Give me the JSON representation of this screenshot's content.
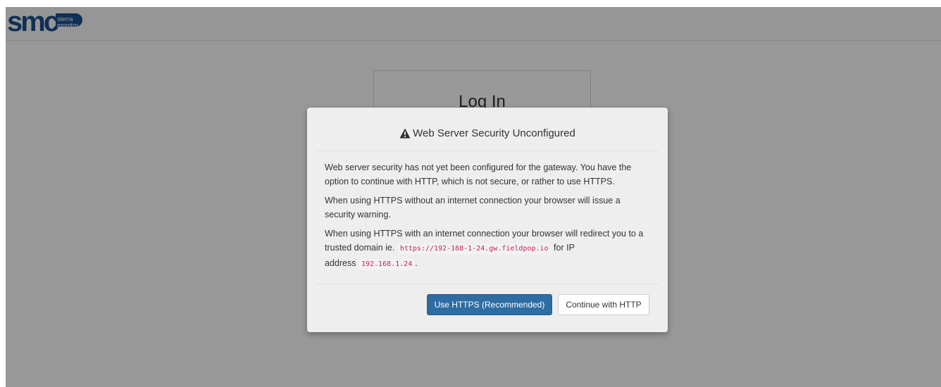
{
  "brand": {
    "logo_mark": "smc",
    "logo_sub_line1": "sierra",
    "logo_sub_line2": "monitor",
    "color": "#1b4f8f"
  },
  "background": {
    "login_title": "Log In"
  },
  "modal": {
    "title": "Web Server Security Unconfigured",
    "icon": "warning-triangle-icon",
    "paragraph1": "Web server security has not yet been configured for the gateway. You have the option to continue with HTTP, which is not secure, or rather to use HTTPS.",
    "paragraph2": "When using HTTPS without an internet connection your browser will issue a security warning.",
    "paragraph3_prefix": "When using HTTPS with an internet connection your browser will redirect you to a trusted domain ie.",
    "paragraph3_url": "https://192-168-1-24.gw.fieldpop.io",
    "paragraph3_middle": "for IP address",
    "paragraph3_ip": "192.168.1.24",
    "paragraph3_suffix": ".",
    "primary_button": "Use HTTPS (Recommended)",
    "secondary_button": "Continue with HTTP"
  },
  "colors": {
    "primary_button": "#2e6da4",
    "code_text": "#c7254e",
    "overlay": "rgba(0,0,0,0.4)"
  }
}
